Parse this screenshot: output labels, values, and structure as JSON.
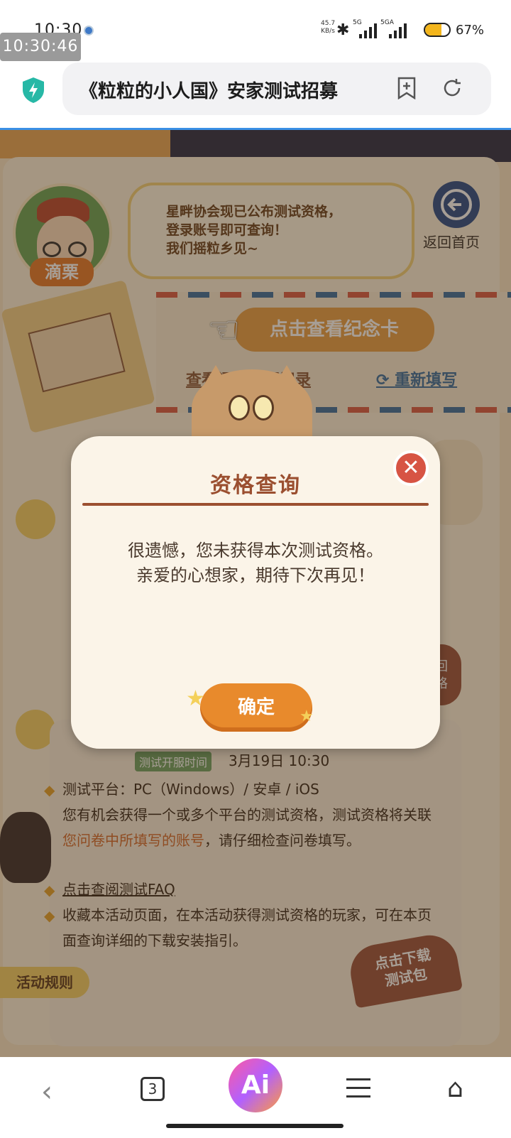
{
  "status_bar": {
    "time": "10:30",
    "clock_overlay": "10:30:46",
    "net_speed": "45.7",
    "net_unit": "KB/s",
    "signal1_label": "5G",
    "signal2_label": "5GA",
    "battery": "67%",
    "battery_level": 0.67
  },
  "browser": {
    "page_title": "《粒粒的小人国》安家测试招募",
    "add_tab_icon": "add-bookmark-icon",
    "reload_icon": "reload-icon"
  },
  "page": {
    "character_name": "滴栗",
    "bubble_lines": [
      "星畔协会现已公布测试资格，",
      "登录账号即可查询！",
      "我们摇粒乡见~"
    ],
    "home_label": "返回首页",
    "memorial_button": "点击查看纪念卡",
    "record_link": "查看问卷填写记录",
    "refill_link": "重新填写",
    "test_open_tag": "测试开服时间",
    "test_open_time": "3月19日 10:30",
    "rule_platform": "测试平台：PC（Windows）/ 安卓 / iOS",
    "rule_account_pre": "您有机会获得一个或多个平台的测试资格，测试资格将关联",
    "rule_account_hl": "您问卷中所填写的账号",
    "rule_account_post": "，请仔细检查问卷填写。",
    "faq_link": "点击查阅测试FAQ",
    "rule_collect": "收藏本活动页面，在本活动获得测试资格的玩家，可在本页面查询详细的下载安装指引。",
    "download_line1": "点击下载",
    "download_line2": "测试包",
    "rules_tab": "活动规则",
    "side_badge_1": "回",
    "side_badge_2": "格"
  },
  "modal": {
    "title": "资格查询",
    "message_line1": "很遗憾，您未获得本次测试资格。",
    "message_line2": "亲爱的心想家，期待下次再见！",
    "confirm": "确定",
    "close_icon": "close-icon"
  },
  "bottom_nav": {
    "back_icon": "back-icon",
    "tabs_count": "3",
    "ai_label": "Ai",
    "menu_icon": "menu-icon",
    "home_icon": "home-icon"
  },
  "colors": {
    "accent": "#e88a2c",
    "modal_title": "#9b4f30",
    "page_bg": "#f7e6c8",
    "shield": "#27b8a6"
  }
}
